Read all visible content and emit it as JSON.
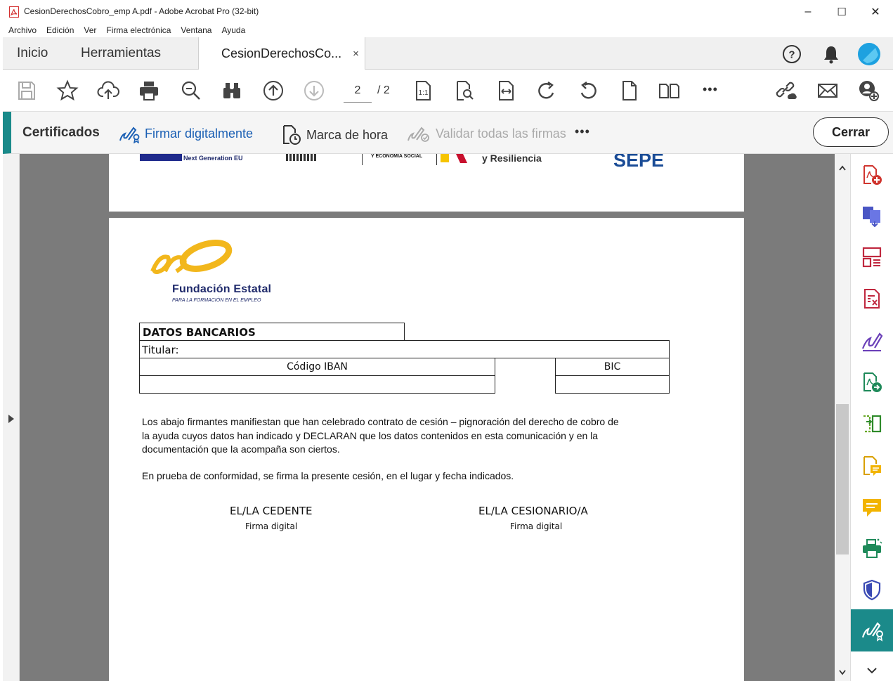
{
  "window": {
    "title": "CesionDerechosCobro_emp A.pdf - Adobe Acrobat Pro (32-bit)",
    "minimize": "–",
    "maximize": "☐",
    "close": "✕"
  },
  "menu": [
    "Archivo",
    "Edición",
    "Ver",
    "Firma electrónica",
    "Ventana",
    "Ayuda"
  ],
  "tabs": {
    "home": "Inicio",
    "tools": "Herramientas",
    "document": "CesionDerechosCo...",
    "close_symbol": "×"
  },
  "toolbar": {
    "page_current": "2",
    "page_total": "/ 2",
    "more": "•••"
  },
  "certificates": {
    "label": "Certificados",
    "sign_digitally": "Firmar digitalmente",
    "timestamp": "Marca de hora",
    "validate_all": "Validar todas las firmas",
    "more": "•••",
    "close_button": "Cerrar"
  },
  "document": {
    "page1_header": {
      "eu_text": "Next Generation EU",
      "ministry_text": "Y ECONOMÍA SOCIAL",
      "resilience_text": "y Resiliencia",
      "sepe_text": "SEPE"
    },
    "logo": {
      "title": "Fundación Estatal",
      "subtitle": "PARA LA FORMACIÓN EN EL EMPLEO"
    },
    "bank": {
      "heading": "DATOS BANCARIOS",
      "holder_label": "Titular:",
      "iban_label": "Código IBAN",
      "bic_label": "BIC"
    },
    "paragraph1": "Los abajo firmantes manifiestan que han celebrado contrato de cesión – pignoración del derecho de cobro de la ayuda cuyos datos han indicado y DECLARAN que los datos contenidos en esta comunicación y en la documentación que la acompaña son ciertos.",
    "paragraph1_lines": [
      "Los abajo firmantes manifiestan que han celebrado contrato de cesión – pignoración del derecho de cobro de",
      "la ayuda cuyos datos han indicado y DECLARAN que los datos contenidos en esta comunicación y en la",
      "documentación que la acompaña son ciertos."
    ],
    "paragraph2": "En prueba de conformidad, se firma la presente cesión, en el lugar y fecha indicados.",
    "signatures": {
      "cedente": "EL/LA CEDENTE",
      "cedente_sub": "Firma digital",
      "cesionario": "EL/LA CESIONARIO/A",
      "cesionario_sub": "Firma digital"
    }
  },
  "colors": {
    "accent_teal": "#1b8a8a",
    "logo_yellow": "#f2b71c",
    "logo_navy": "#1f2a6b",
    "canvas_gray": "#7b7b7b",
    "sign_blue": "#1a5fb4"
  }
}
